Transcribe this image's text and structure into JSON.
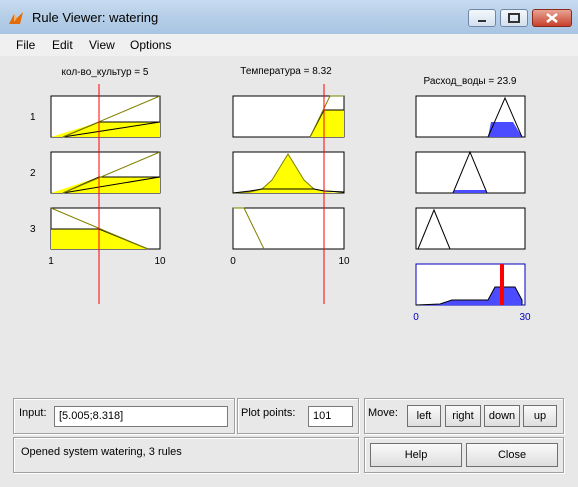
{
  "window": {
    "title": "Rule Viewer: watering",
    "controls": [
      "minimize",
      "maximize",
      "close"
    ]
  },
  "menu": [
    "File",
    "Edit",
    "View",
    "Options"
  ],
  "plot": {
    "inputs": [
      {
        "header": "кол-во_культур = 5",
        "range_min": "1",
        "range_max": "10",
        "value": 5
      },
      {
        "header": "Температура = 8.32",
        "range_min": "0",
        "range_max": "10",
        "value": 8.32
      }
    ],
    "output": {
      "header": "Расход_воды = 23.9",
      "range_min": "0",
      "range_max": "30",
      "value": 23.9
    },
    "rule_numbers": [
      "1",
      "2",
      "3"
    ]
  },
  "controls": {
    "input_label": "Input:",
    "input_value": "[5.005;8.318]",
    "plot_points_label": "Plot points:",
    "plot_points_value": "101",
    "move_label": "Move:",
    "move_buttons": [
      "left",
      "right",
      "down",
      "up"
    ],
    "status": "Opened system watering, 3 rules",
    "help": "Help",
    "close": "Close"
  },
  "colors": {
    "fill": "#ffff00",
    "mf_line": "#808000",
    "marker": "#ff0000",
    "output_fill": "#4b4bff",
    "axis_text": "#0000c0"
  }
}
